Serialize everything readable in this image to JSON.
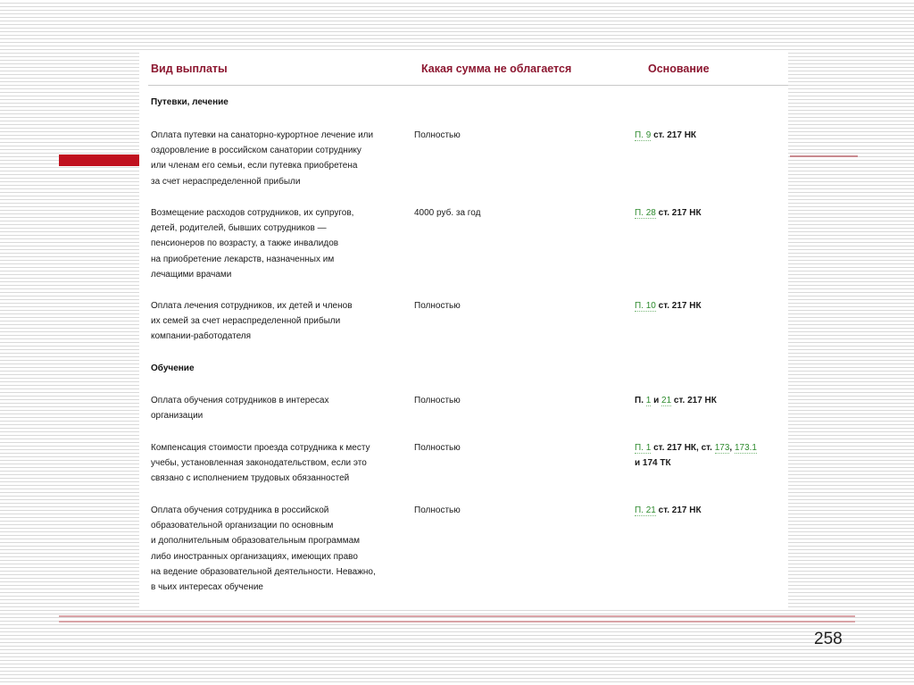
{
  "page_number": "258",
  "headers": {
    "col1": "Вид выплаты",
    "col2": "Какая сумма не облагается",
    "col3": "Основание"
  },
  "sections": [
    {
      "title": "Путевки, лечение"
    },
    {
      "title": "Обучение"
    }
  ],
  "rows": [
    {
      "lines": [
        "Оплата путевки на санаторно-курортное лечение или",
        "оздоровление в российском санатории сотруднику",
        "или членам его семьи, если путевка приобретена",
        "за счет нераспределенной прибыли"
      ],
      "amount": "Полностью",
      "basis": [
        {
          "text": "П. 9",
          "link": true
        },
        {
          "text": " ст. 217 НК",
          "link": false
        }
      ]
    },
    {
      "lines": [
        "Возмещение расходов сотрудников, их супругов,",
        "детей, родителей, бывших сотрудников —",
        "пенсионеров по возрасту, а также инвалидов",
        "на приобретение лекарств, назначенных им",
        "лечащими врачами"
      ],
      "amount": "4000 руб. за год",
      "basis": [
        {
          "text": "П. 28",
          "link": true
        },
        {
          "text": " ст. 217 НК",
          "link": false
        }
      ]
    },
    {
      "lines": [
        "Оплата лечения сотрудников, их детей и членов",
        "их семей за счет нераспределенной прибыли",
        "компании-работодателя"
      ],
      "amount": "Полностью",
      "basis": [
        {
          "text": "П. 10",
          "link": true
        },
        {
          "text": " ст. 217 НК",
          "link": false
        }
      ]
    },
    {
      "lines": [
        "Оплата обучения сотрудников в интересах",
        "организации"
      ],
      "amount": "Полностью",
      "basis": [
        {
          "text": "П. ",
          "link": false
        },
        {
          "text": "1",
          "link": true
        },
        {
          "text": " и ",
          "link": false
        },
        {
          "text": "21",
          "link": true
        },
        {
          "text": " ст. 217 НК",
          "link": false
        }
      ]
    },
    {
      "lines": [
        "Компенсация стоимости проезда сотрудника к месту",
        "учебы, установленная законодательством, если это",
        "связано с исполнением трудовых обязанностей"
      ],
      "amount": "Полностью",
      "basis": [
        {
          "text": "П. 1",
          "link": true
        },
        {
          "text": " ст. 217 НК, ст. ",
          "link": false
        },
        {
          "text": "173",
          "link": true
        },
        {
          "text": ", ",
          "link": false
        },
        {
          "text": "173.1",
          "link": true
        },
        {
          "text": "\nи 174 ТК",
          "link": false
        }
      ]
    },
    {
      "lines": [
        "Оплата обучения сотрудника в российской",
        "образовательной организации по основным",
        "и дополнительным образовательным программам",
        "либо иностранных организациях, имеющих право",
        "на ведение образовательной деятельности. Неважно,",
        "в чьих интересах обучение"
      ],
      "amount": "Полностью",
      "basis": [
        {
          "text": "П. 21",
          "link": true
        },
        {
          "text": " ст. 217 НК",
          "link": false
        }
      ]
    }
  ]
}
